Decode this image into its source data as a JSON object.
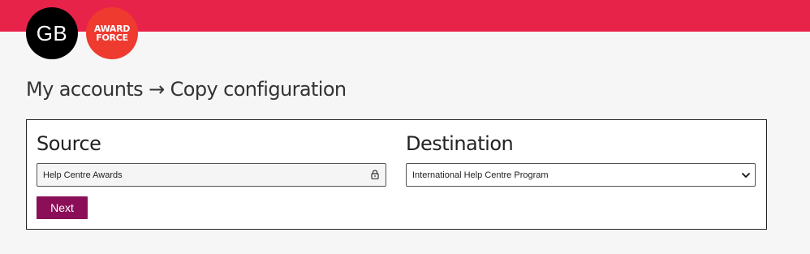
{
  "header": {
    "avatar_initials": "GB",
    "logo_line1": "AWARD",
    "logo_line2": "FORCE",
    "bar_color": "#e8234a"
  },
  "breadcrumb": {
    "text": "My accounts → Copy configuration"
  },
  "form": {
    "source_heading": "Source",
    "source_value": "Help Centre Awards",
    "source_locked": true,
    "destination_heading": "Destination",
    "destination_value": "International Help Centre Program",
    "next_label": "Next",
    "button_color": "#8a0f58"
  }
}
